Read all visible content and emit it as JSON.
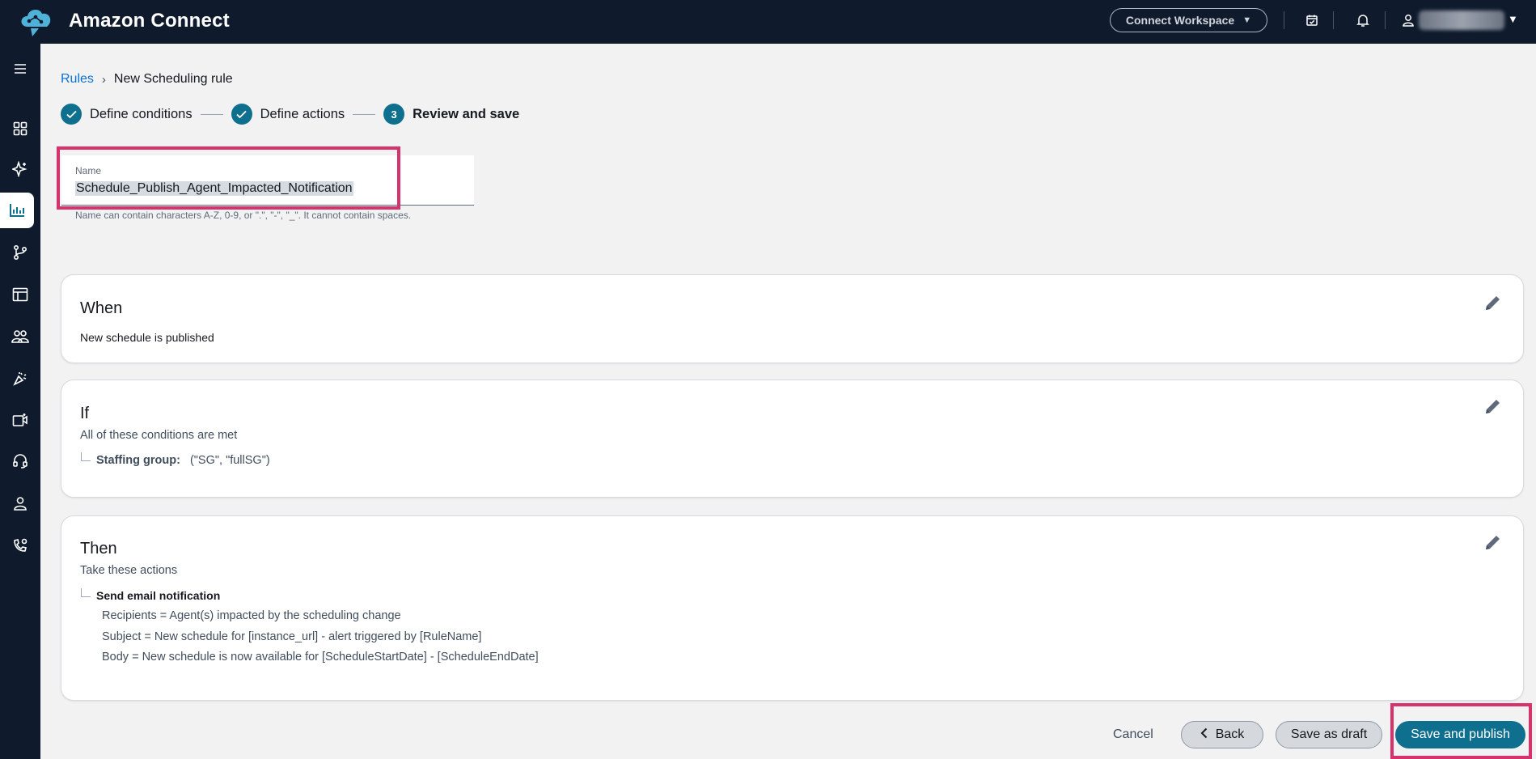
{
  "topbar": {
    "app_title": "Amazon Connect",
    "workspace_label": "Connect Workspace",
    "icons": [
      "calendar-check-icon",
      "bell-icon",
      "user-icon"
    ]
  },
  "sidenav": {
    "items": [
      {
        "icon": "menu-icon"
      },
      {
        "icon": "dashboard-grid-icon"
      },
      {
        "icon": "sparkle-icon"
      },
      {
        "icon": "analytics-chart-icon",
        "active": true
      },
      {
        "icon": "routing-branch-icon"
      },
      {
        "icon": "layout-table-icon"
      },
      {
        "icon": "users-icon"
      },
      {
        "icon": "campaign-icon"
      },
      {
        "icon": "channels-icon"
      },
      {
        "icon": "headset-icon"
      },
      {
        "icon": "user-icon"
      },
      {
        "icon": "phone-settings-icon"
      }
    ]
  },
  "breadcrumb": {
    "root": "Rules",
    "current": "New Scheduling rule"
  },
  "stepper": {
    "steps": [
      {
        "label": "Define conditions",
        "status": "complete"
      },
      {
        "label": "Define actions",
        "status": "complete"
      },
      {
        "label": "Review and save",
        "number": "3",
        "status": "current"
      }
    ]
  },
  "name_field": {
    "label": "Name",
    "value": "Schedule_Publish_Agent_Impacted_Notification",
    "hint": "Name can contain characters A-Z, 0-9, or \".\", \"-\", \"_\". It cannot contain spaces."
  },
  "when_card": {
    "title": "When",
    "text": "New schedule is published"
  },
  "if_card": {
    "title": "If",
    "subtitle": "All of these conditions are met",
    "condition_label": "Staffing group:",
    "condition_value": "(\"SG\", \"fullSG\")"
  },
  "then_card": {
    "title": "Then",
    "subtitle": "Take these actions",
    "action_label": "Send email notification",
    "details": [
      "Recipients = Agent(s) impacted by the scheduling change",
      "Subject = New schedule for [instance_url] - alert triggered by [RuleName]",
      "Body = New schedule is now available for [ScheduleStartDate] - [ScheduleEndDate]"
    ]
  },
  "footer": {
    "cancel_label": "Cancel",
    "back_label": "Back",
    "draft_label": "Save as draft",
    "publish_label": "Save and publish"
  },
  "colors": {
    "topbar_bg": "#0f1b2d",
    "primary": "#0f6f8f",
    "link": "#0972d3",
    "highlight": "#d6336c"
  }
}
